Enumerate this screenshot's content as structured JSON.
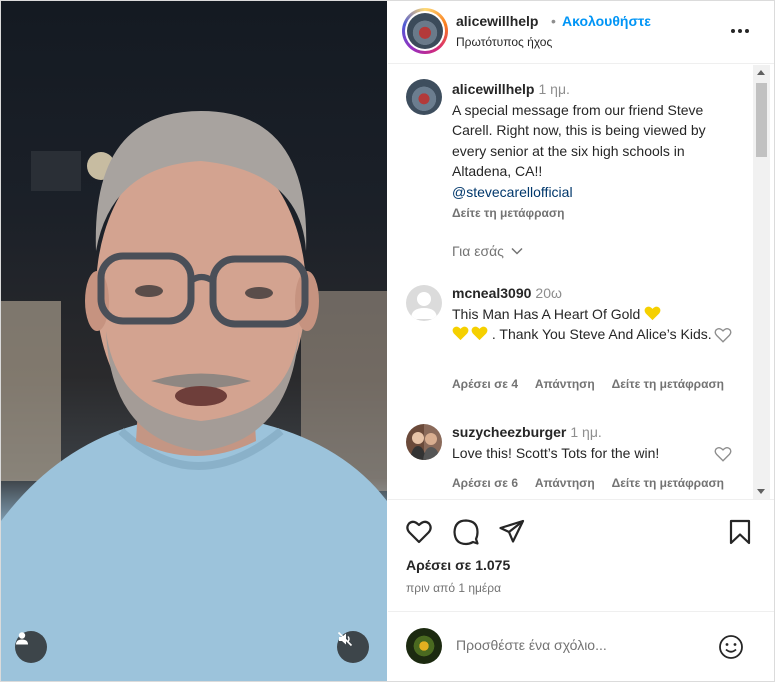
{
  "post": {
    "username": "alicewillhelp",
    "dot": "•",
    "follow_label": "Ακολουθήστε",
    "audio_label": "Πρωτότυπος ήχος"
  },
  "caption": {
    "username": "alicewillhelp",
    "time": "1 ημ.",
    "text": "A special message from our friend Steve Carell. Right now, this is being viewed by every senior at the six high schools in Altadena, CA!!",
    "mention": "@stevecarellofficial",
    "translate_label": "Δείτε τη μετάφραση"
  },
  "for_you_label": "Για εσάς",
  "comments": [
    {
      "username": "mcneal3090",
      "time": "20ω",
      "text_part1": "This Man Has A Heart Of Gold",
      "text_part2": ". Thank You Steve And Alice’s Kids.",
      "likes_label": "Αρέσει σε 4",
      "reply_label": "Απάντηση",
      "translate_label": "Δείτε τη μετάφραση"
    },
    {
      "username": "suzycheezburger",
      "time": "1 ημ.",
      "text": "Love this! Scott’s Tots for the win!",
      "likes_label": "Αρέσει σε 6",
      "reply_label": "Απάντηση",
      "translate_label": "Δείτε τη μετάφραση"
    }
  ],
  "likes_count_label": "Αρέσει σε 1.075",
  "posted_label": "πριν από 1 ημέρα",
  "add_comment": {
    "placeholder": "Προσθέστε ένα σχόλιο..."
  },
  "colors": {
    "accent_blue": "#0095f6",
    "mention": "#00376b",
    "heart_emoji": "#f5d000"
  },
  "icons": [
    "user-tag-icon",
    "muted-speaker-icon",
    "more-options-icon",
    "heart-icon",
    "comment-icon",
    "share-icon",
    "bookmark-icon",
    "emoji-icon",
    "chevron-down-icon",
    "yellow-heart-emoji"
  ]
}
